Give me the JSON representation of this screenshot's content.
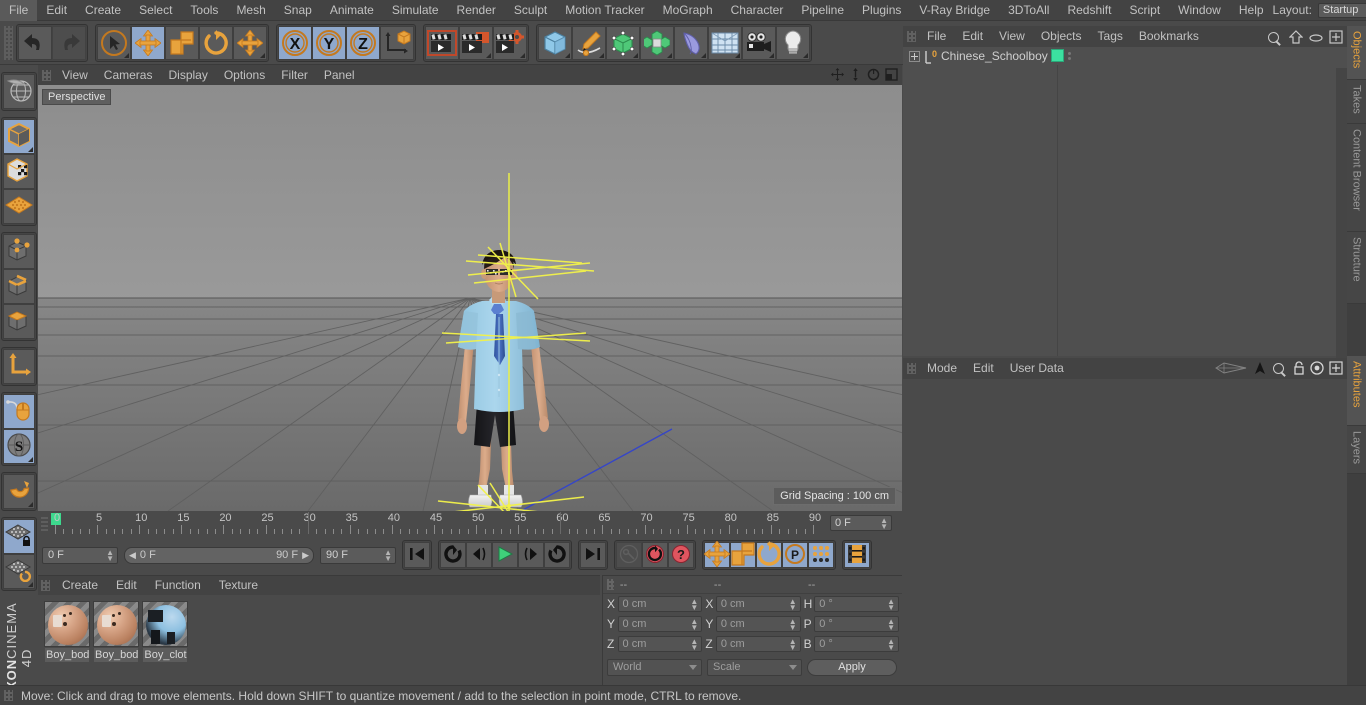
{
  "menubar": {
    "items": [
      "File",
      "Edit",
      "Create",
      "Select",
      "Tools",
      "Mesh",
      "Snap",
      "Animate",
      "Simulate",
      "Render",
      "Sculpt",
      "Motion Tracker",
      "MoGraph",
      "Character",
      "Pipeline",
      "Plugins",
      "V-Ray Bridge",
      "3DToAll",
      "Redshift",
      "Script",
      "Window",
      "Help"
    ],
    "layout_label": "Layout:",
    "layout_value": "Startup",
    "search_icon": "search-icon"
  },
  "toolbar": {
    "groups": [
      {
        "name": "undo-redo",
        "items": [
          {
            "name": "undo-button",
            "icon": "undo-arrow-icon",
            "selected": false,
            "dim": false,
            "corner": false
          },
          {
            "name": "redo-button",
            "icon": "redo-arrow-icon",
            "selected": false,
            "dim": true,
            "corner": false
          }
        ]
      },
      {
        "name": "transform-tools",
        "items": [
          {
            "name": "live-selection-tool",
            "icon": "cursor-circle-icon",
            "selected": false,
            "dim": false,
            "corner": true
          },
          {
            "name": "move-tool",
            "icon": "move-arrows-icon",
            "selected": true,
            "dim": false,
            "corner": false
          },
          {
            "name": "scale-tool",
            "icon": "scale-box-icon",
            "selected": false,
            "dim": false,
            "corner": false
          },
          {
            "name": "rotate-tool",
            "icon": "rotate-arc-icon",
            "selected": false,
            "dim": false,
            "corner": false
          },
          {
            "name": "transform-tool",
            "icon": "move-arrows-icon",
            "selected": false,
            "dim": false,
            "corner": true
          }
        ]
      },
      {
        "name": "axis-locks",
        "items": [
          {
            "name": "x-axis-lock",
            "icon": "x-axis-icon",
            "label": "X",
            "selected": true,
            "dim": false,
            "corner": false
          },
          {
            "name": "y-axis-lock",
            "icon": "y-axis-icon",
            "label": "Y",
            "selected": true,
            "dim": false,
            "corner": false
          },
          {
            "name": "z-axis-lock",
            "icon": "z-axis-icon",
            "label": "Z",
            "selected": true,
            "dim": false,
            "corner": false
          },
          {
            "name": "world-object-coordinate-toggle",
            "icon": "world-axis-cube-icon",
            "selected": false,
            "dim": false,
            "corner": false
          }
        ]
      },
      {
        "name": "render-group",
        "items": [
          {
            "name": "render-view-button",
            "icon": "clapperboard-view-icon",
            "selected": false,
            "dim": false,
            "corner": false
          },
          {
            "name": "render-to-picture-viewer-button",
            "icon": "clapperboard-picture-icon",
            "selected": false,
            "dim": false,
            "corner": true
          },
          {
            "name": "render-settings-button",
            "icon": "clapperboard-gear-icon",
            "selected": false,
            "dim": false,
            "corner": true
          }
        ]
      },
      {
        "name": "create-group",
        "items": [
          {
            "name": "add-cube-button",
            "icon": "blue-cube-icon",
            "selected": false,
            "dim": false,
            "corner": true
          },
          {
            "name": "add-spline-button",
            "icon": "pen-spline-icon",
            "selected": false,
            "dim": false,
            "corner": true
          },
          {
            "name": "add-nurbs-button",
            "icon": "green-cube-points-icon",
            "selected": false,
            "dim": false,
            "corner": true
          },
          {
            "name": "add-array-button",
            "icon": "green-cluster-icon",
            "selected": false,
            "dim": false,
            "corner": true
          },
          {
            "name": "add-deformer-button",
            "icon": "bend-deformer-icon",
            "selected": false,
            "dim": false,
            "corner": true
          },
          {
            "name": "add-scene-object-button",
            "icon": "floor-grid-icon",
            "selected": false,
            "dim": false,
            "corner": true
          },
          {
            "name": "add-camera-button",
            "icon": "camera-icon",
            "selected": false,
            "dim": false,
            "corner": true
          },
          {
            "name": "add-light-button",
            "icon": "lightbulb-icon",
            "selected": false,
            "dim": false,
            "corner": true
          }
        ]
      }
    ]
  },
  "left_toolbar": {
    "items": [
      {
        "name": "make-editable-button",
        "icon": "globe-wire-icon",
        "selected": false,
        "corner": false
      },
      {
        "name": "model-mode-button",
        "icon": "grey-cube-orange-outline-icon",
        "selected": true,
        "corner": true
      },
      {
        "name": "texture-mode-button",
        "icon": "checker-cube-icon",
        "selected": false,
        "corner": false
      },
      {
        "name": "workplane-mode-button",
        "icon": "orange-grid-plane-icon",
        "selected": false,
        "corner": false
      },
      {
        "name": "point-mode-button",
        "icon": "cube-points-icon",
        "selected": false,
        "corner": false
      },
      {
        "name": "edge-mode-button",
        "icon": "cube-edges-icon",
        "selected": false,
        "corner": false
      },
      {
        "name": "polygon-mode-button",
        "icon": "cube-polygon-icon",
        "selected": false,
        "corner": false
      },
      {
        "name": "axis-modify-button",
        "icon": "orange-axis-icon",
        "selected": false,
        "corner": false
      },
      {
        "name": "enable-snapping-button",
        "icon": "mouse-snap-icon",
        "selected": true,
        "corner": false
      },
      {
        "name": "soft-selection-button",
        "icon": "s-sphere-icon",
        "selected": true,
        "corner": true
      },
      {
        "name": "magnet-tool-button",
        "icon": "magnet-icon",
        "selected": false,
        "corner": true
      },
      {
        "name": "lock-workplane-button",
        "icon": "grid-lock-icon",
        "selected": true,
        "corner": false
      },
      {
        "name": "planar-workplane-button",
        "icon": "grid-rotate-icon",
        "selected": false,
        "corner": true
      }
    ],
    "brand_bold": "MAXON",
    "brand_light": "CINEMA 4D"
  },
  "viewport": {
    "menu_items": [
      "View",
      "Cameras",
      "Display",
      "Options",
      "Filter",
      "Panel"
    ],
    "nav_icons": [
      "pan-icon",
      "zoom-dolly-icon",
      "rotate-orbit-icon",
      "maximize-view-icon"
    ],
    "perspective_label": "Perspective",
    "grid_spacing_label": "Grid Spacing : 100 cm",
    "scene": {
      "character": "Chinese schoolboy 3D model",
      "shirt_color": "#9fcfe8",
      "tie_color": "#3b63b8",
      "shorts_color": "#1f1f22",
      "skin_color": "#d8a88a",
      "hair_color": "#241b16",
      "shoe_color": "#e8e8e8",
      "selection_color": "#f2f24a",
      "axis_x_color": "#cc3333",
      "axis_y_color": "#33aa33",
      "axis_z_color": "#3344cc"
    }
  },
  "timeline": {
    "start": 0,
    "end": 90,
    "step": 5,
    "labels": [
      "0",
      "5",
      "10",
      "15",
      "20",
      "25",
      "30",
      "35",
      "40",
      "45",
      "50",
      "55",
      "60",
      "65",
      "70",
      "75",
      "80",
      "85",
      "90"
    ],
    "current_frame_field": "0 F",
    "playhead_frame": 0
  },
  "playback": {
    "current_frame": "0 F",
    "range_start": "0 F",
    "range_end": "90 F",
    "max_frame": "90 F",
    "buttons": [
      {
        "name": "go-to-start-button",
        "icon": "skip-start-icon",
        "selected": false,
        "dim": false
      },
      {
        "name": "play-reverse-loop-button",
        "icon": "loop-back-icon",
        "selected": false,
        "dim": false
      },
      {
        "name": "step-back-button",
        "icon": "step-back-icon",
        "selected": false,
        "dim": false
      },
      {
        "name": "play-button",
        "icon": "play-triangle-icon",
        "selected": false,
        "dim": false
      },
      {
        "name": "step-forward-button",
        "icon": "step-forward-icon",
        "selected": false,
        "dim": false
      },
      {
        "name": "play-forward-loop-button",
        "icon": "loop-forward-icon",
        "selected": false,
        "dim": false
      },
      {
        "name": "go-to-end-button",
        "icon": "skip-end-icon",
        "selected": false,
        "dim": false
      }
    ],
    "record_buttons": [
      {
        "name": "autokeying-toggle",
        "icon": "key-icon",
        "selected": false,
        "dim": true
      },
      {
        "name": "record-active-objects-button",
        "icon": "red-circle-ring-icon",
        "selected": false,
        "dim": false
      },
      {
        "name": "autokeying-button",
        "icon": "red-circle-dot-icon",
        "selected": false,
        "dim": false
      }
    ],
    "key_toggles": [
      {
        "name": "key-position-toggle",
        "icon": "move-arrows-icon",
        "selected": true
      },
      {
        "name": "key-scale-toggle",
        "icon": "scale-box-icon",
        "selected": true
      },
      {
        "name": "key-rotation-toggle",
        "icon": "rotate-arc-icon",
        "selected": true
      },
      {
        "name": "key-parameter-toggle",
        "icon": "p-circle-icon",
        "selected": true
      },
      {
        "name": "key-pla-toggle",
        "icon": "dot-grid-icon",
        "selected": true
      }
    ],
    "timeline_mode_button": {
      "name": "animation-mode-toggle",
      "icon": "film-strip-icon",
      "selected": true
    }
  },
  "material_manager": {
    "menu_items": [
      "Create",
      "Edit",
      "Function",
      "Texture"
    ],
    "materials": [
      {
        "name": "Boy_bod",
        "display": "Boy_bod",
        "type": "skin"
      },
      {
        "name": "Boy_bod",
        "display": "Boy_bod",
        "type": "skin"
      },
      {
        "name": "Boy_clot",
        "display": "Boy_clot",
        "type": "cloth"
      }
    ]
  },
  "coordinate_manager": {
    "column_headers": [
      "--",
      "--",
      "--"
    ],
    "rows": [
      {
        "pos_label": "X",
        "pos_value": "0 cm",
        "size_label": "X",
        "size_value": "0 cm",
        "rot_label": "H",
        "rot_value": "0 °"
      },
      {
        "pos_label": "Y",
        "pos_value": "0 cm",
        "size_label": "Y",
        "size_value": "0 cm",
        "rot_label": "P",
        "rot_value": "0 °"
      },
      {
        "pos_label": "Z",
        "pos_value": "0 cm",
        "size_label": "Z",
        "size_value": "0 cm",
        "rot_label": "B",
        "rot_value": "0 °"
      }
    ],
    "coord_system": "World",
    "transform_mode": "Scale",
    "apply_label": "Apply"
  },
  "object_manager": {
    "menu_items": [
      "File",
      "Edit",
      "View",
      "Objects",
      "Tags",
      "Bookmarks"
    ],
    "header_icons": [
      "search-icon",
      "home-icon",
      "eye-icon",
      "expand-icon"
    ],
    "objects": [
      {
        "name": "Chinese_Schoolboy",
        "type": "null-object",
        "tag_color": "#3ce0a0",
        "expandable": true
      }
    ]
  },
  "attribute_manager": {
    "menu_items": [
      "Mode",
      "Edit",
      "User Data"
    ],
    "header_icons": [
      "wireframe-icon",
      "arrow-up-icon",
      "search-icon",
      "lock-icon",
      "target-icon",
      "expand-icon"
    ]
  },
  "edge_tabs": {
    "top_group": [
      {
        "label": "Objects",
        "active": true
      },
      {
        "label": "Takes",
        "active": false
      },
      {
        "label": "Content Browser",
        "active": false
      },
      {
        "label": "Structure",
        "active": false
      }
    ],
    "bottom_group": [
      {
        "label": "Attributes",
        "active": true
      },
      {
        "label": "Layers",
        "active": false
      }
    ]
  },
  "status_bar": {
    "message": "Move: Click and drag to move elements. Hold down SHIFT to quantize movement / add to the selection in point mode, CTRL to remove."
  }
}
